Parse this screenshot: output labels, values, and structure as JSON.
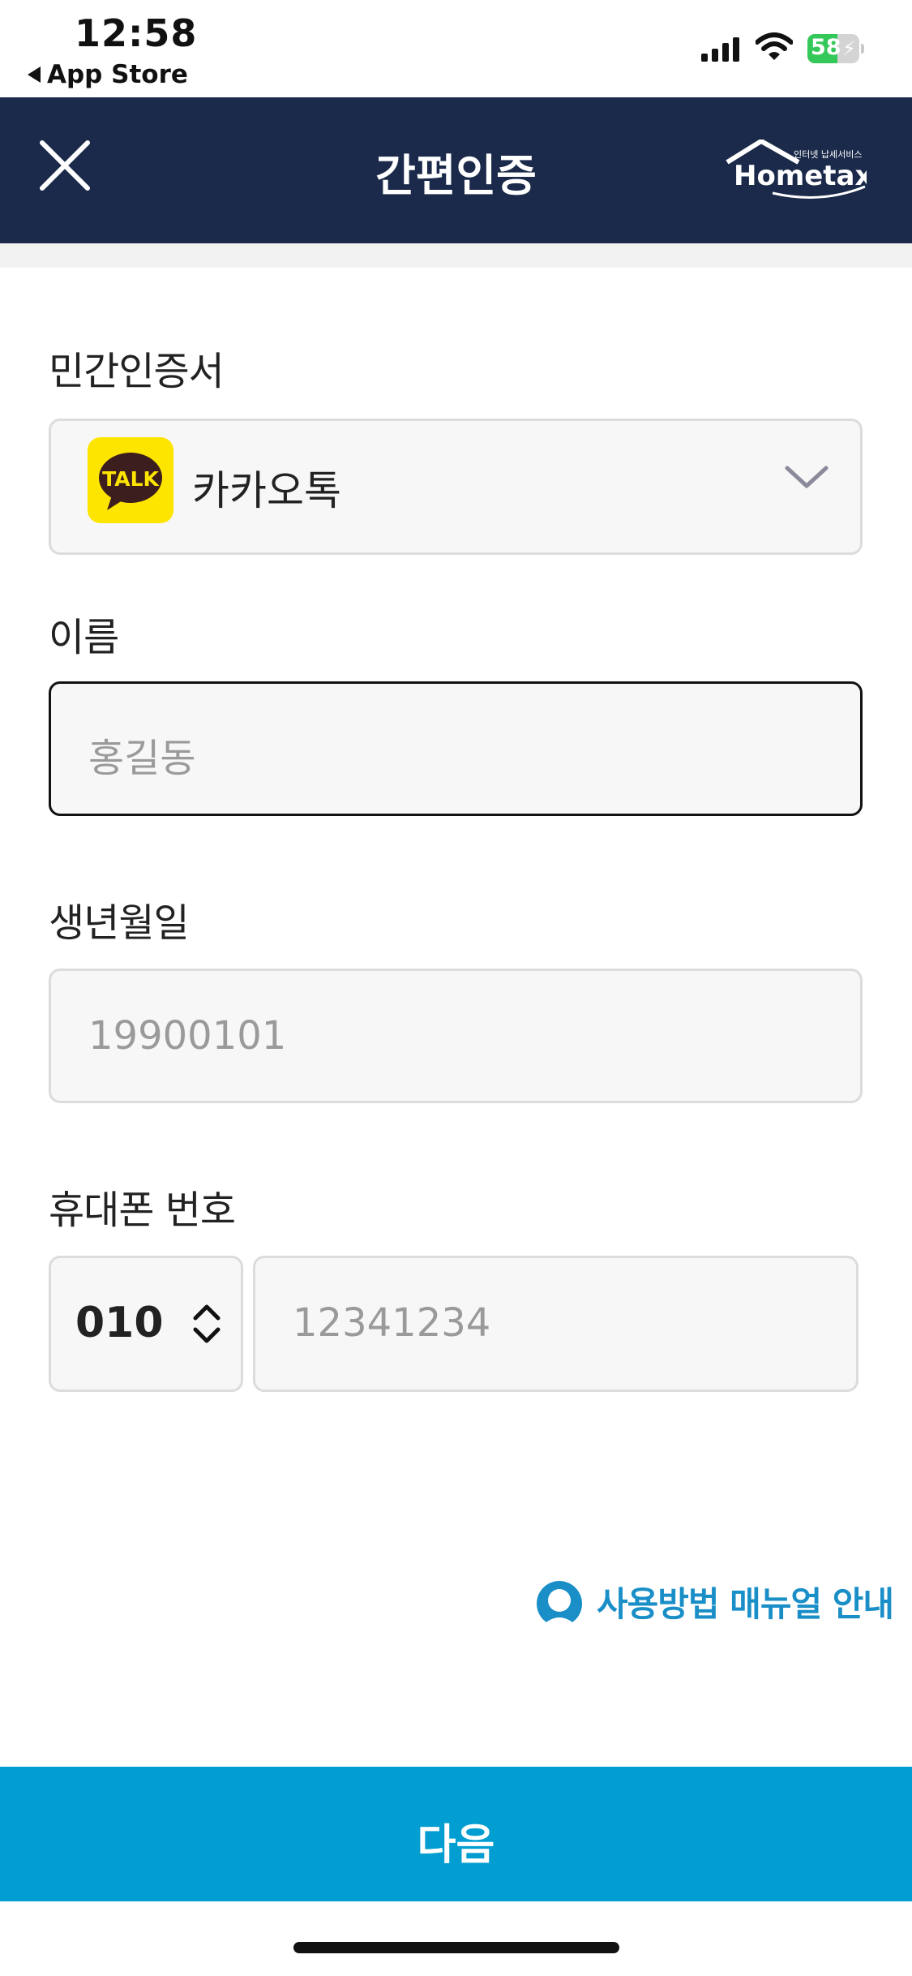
{
  "status_bar": {
    "time": "12:58",
    "back_app_label": "App Store",
    "battery_percent": "58",
    "battery_level": 0.58,
    "battery_color": "#34c759",
    "icons": [
      "signal-icon",
      "wifi-icon",
      "battery-icon",
      "charging-bolt-icon"
    ]
  },
  "header": {
    "title": "간편인증",
    "close_icon": "close-icon",
    "logo": {
      "text": "Hometax.",
      "tagline": "인터넷 납세서비스"
    },
    "background_color": "#1b2a4a"
  },
  "form": {
    "certificate": {
      "label": "민간인증서",
      "selected": "카카오톡",
      "icon_text": "TALK",
      "icon": "kakaotalk-icon",
      "dropdown_icon": "chevron-down-icon"
    },
    "name": {
      "label": "이름",
      "placeholder": "홍길동",
      "value": ""
    },
    "birth": {
      "label": "생년월일",
      "placeholder": "19900101",
      "value": ""
    },
    "phone": {
      "label": "휴대폰 번호",
      "prefix": "010",
      "prefix_icon": "updown-chevron-icon",
      "placeholder": "12341234",
      "value": ""
    }
  },
  "manual_link": {
    "label": "사용방법 매뉴얼 안내",
    "icon": "user-guide-icon",
    "color": "#1a8fc7"
  },
  "next_button": {
    "label": "다음",
    "color": "#029ed1"
  }
}
